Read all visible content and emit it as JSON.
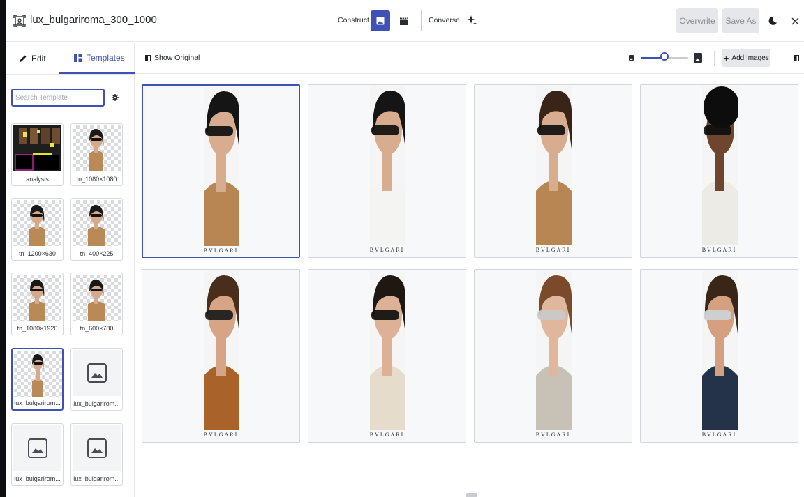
{
  "header": {
    "app_icon": "frame-icon",
    "title": "lux_bulgariroma_300_1000",
    "construct_label": "Construct",
    "converse_label": "Converse",
    "overwrite_label": "Overwrite",
    "save_as_label": "Save As",
    "icons": [
      "image-icon",
      "clapperboard-icon",
      "sparkle-icon",
      "moon-icon",
      "close-icon"
    ]
  },
  "sidebar": {
    "tabs": [
      {
        "label": "Edit",
        "icon": "pencil-icon"
      },
      {
        "label": "Templates",
        "icon": "grid-icon"
      }
    ],
    "search_placeholder": "Search Template",
    "templates": [
      {
        "label": "analysis"
      },
      {
        "label": "tn_1080×1080"
      },
      {
        "label": "tn_1200×630"
      },
      {
        "label": "tn_400×225"
      },
      {
        "label": "tn_1080×1920"
      },
      {
        "label": "tn_600×780"
      },
      {
        "label": "lux_bulgarirom..."
      },
      {
        "label": "lux_bulgarirom..."
      },
      {
        "label": "lux_bulgarirom..."
      },
      {
        "label": "lux_bulgarirom..."
      }
    ]
  },
  "toolbar": {
    "show_original_label": "Show Original",
    "add_images_label": "Add Images",
    "zoom_level": 0.5
  },
  "gallery": {
    "brand": "BVLGARI",
    "count": 8
  },
  "colors": {
    "accent": "#3f51b5",
    "disabled_button": "#e6e7ea"
  }
}
